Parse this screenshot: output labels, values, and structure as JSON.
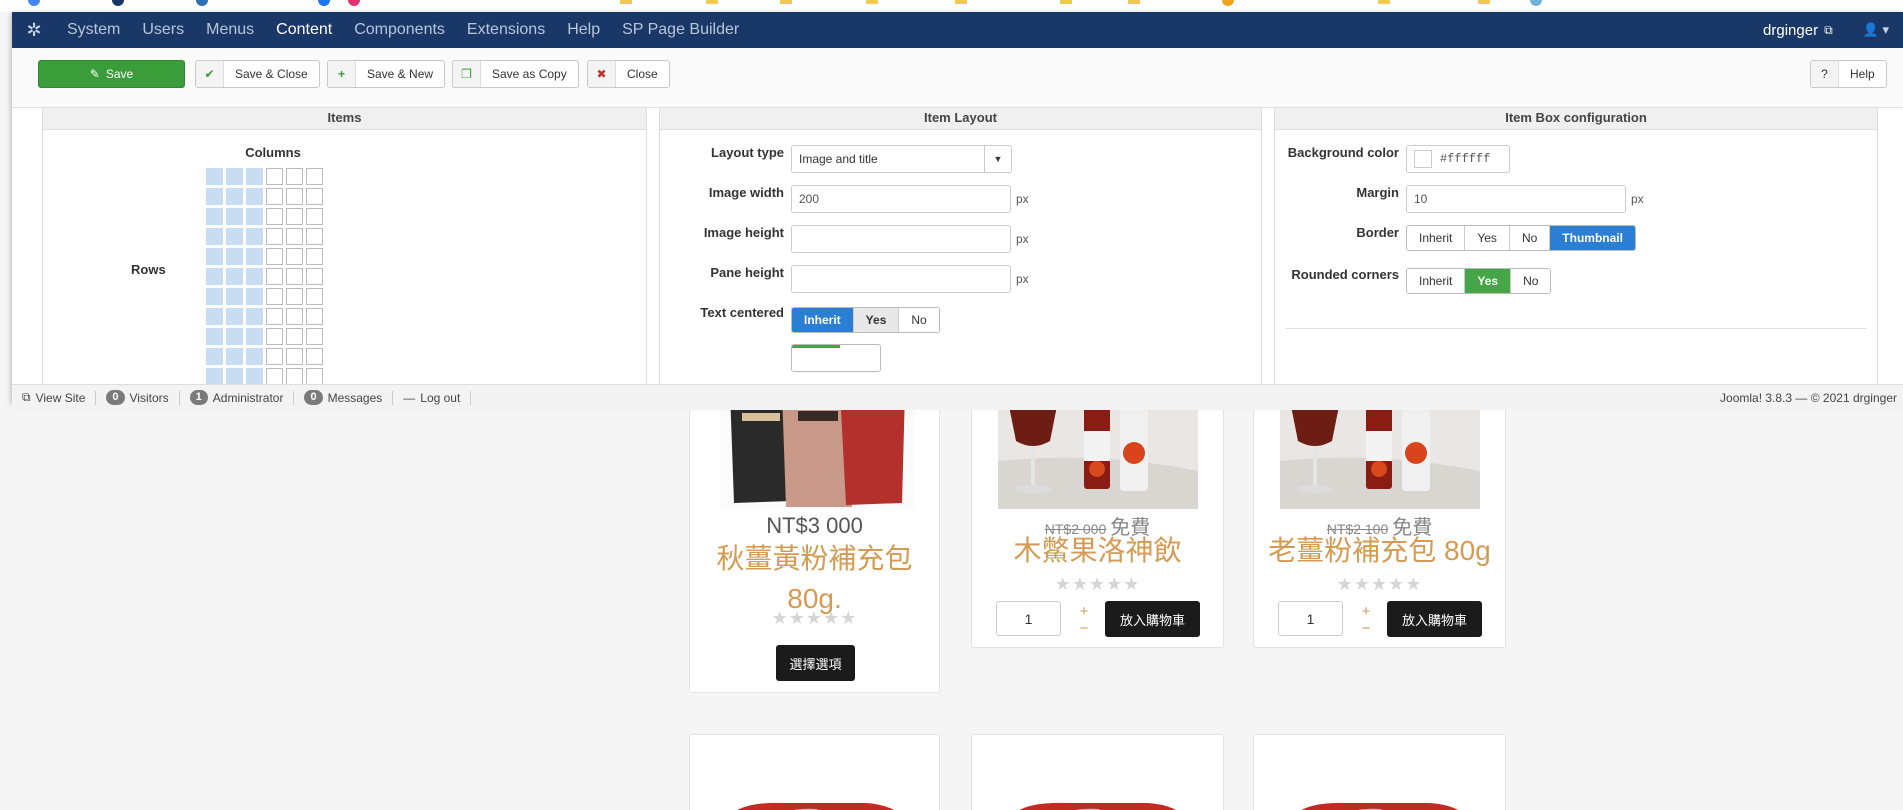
{
  "navbar": {
    "items": [
      "System",
      "Users",
      "Menus",
      "Content",
      "Components",
      "Extensions",
      "Help",
      "SP Page Builder"
    ],
    "active": "Content",
    "user": "drginger"
  },
  "toolbar": {
    "save": "Save",
    "save_close": "Save & Close",
    "save_new": "Save & New",
    "save_copy": "Save as Copy",
    "close": "Close",
    "help": "Help"
  },
  "items_panel": {
    "title": "Items",
    "columns_label": "Columns",
    "rows_label": "Rows",
    "selected_columns": 3,
    "grid_columns": 6,
    "visible_rows": 11
  },
  "layout_panel": {
    "title": "Item Layout",
    "layout_type_label": "Layout type",
    "layout_type_value": "Image and title",
    "image_width_label": "Image width",
    "image_width_value": "200",
    "image_height_label": "Image height",
    "image_height_value": "",
    "pane_height_label": "Pane height",
    "pane_height_value": "",
    "unit": "px",
    "text_centered_label": "Text centered",
    "text_centered_options": [
      "Inherit",
      "Yes",
      "No"
    ],
    "text_centered_selected": "Inherit"
  },
  "box_panel": {
    "title": "Item Box configuration",
    "bg_color_label": "Background color",
    "bg_color_value": "#ffffff",
    "margin_label": "Margin",
    "margin_value": "10",
    "unit": "px",
    "border_label": "Border",
    "border_options": [
      "Inherit",
      "Yes",
      "No",
      "Thumbnail"
    ],
    "border_selected": "Thumbnail",
    "rounded_label": "Rounded corners",
    "rounded_options": [
      "Inherit",
      "Yes",
      "No"
    ],
    "rounded_selected": "Yes"
  },
  "footer": {
    "view_site": "View Site",
    "visitors_count": "0",
    "visitors_label": "Visitors",
    "admin_count": "1",
    "admin_label": "Administrator",
    "messages_count": "0",
    "messages_label": "Messages",
    "logout": "Log out",
    "copyright": "Joomla! 3.8.3 — © 2021 drginger"
  },
  "products": [
    {
      "price": "NT$3 000",
      "old_price": "",
      "free_label": "",
      "name": "秋薑黃粉補充包 80g.",
      "button": "選擇選項",
      "qty": ""
    },
    {
      "price": "",
      "old_price": "NT$2 000",
      "free_label": "免費",
      "name": "木鱉果洛神飲",
      "button": "放入購物車",
      "qty": "1"
    },
    {
      "price": "",
      "old_price": "NT$2 100",
      "free_label": "免費",
      "name": "老薑粉補充包 80g",
      "button": "放入購物車",
      "qty": "1"
    }
  ],
  "colors": {
    "navbar": "#1a3867",
    "save_button": "#3a9d3a",
    "selected_blue": "#2a7fd4",
    "selected_green": "#46a546",
    "product_name": "#d69b52"
  }
}
